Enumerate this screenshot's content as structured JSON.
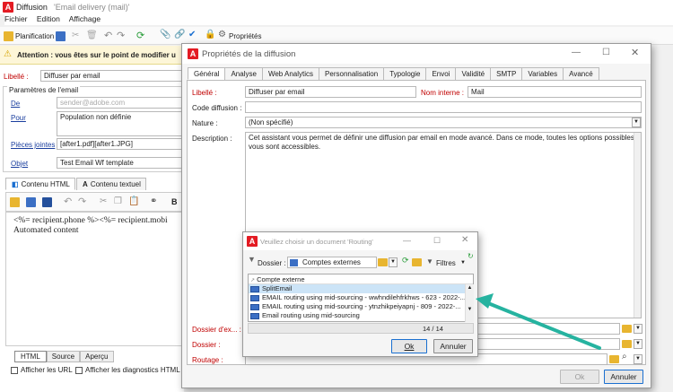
{
  "main_window": {
    "title": "Diffusion",
    "subtitle": "'Email delivery (mail)'",
    "menu": [
      "Fichier",
      "Edition",
      "Affichage"
    ],
    "toolbar": {
      "planification": "Planification",
      "proprietes": "Propriétés"
    },
    "warning": "Attention : vous êtes sur le point de modifier u",
    "libelle_label": "Libellé :",
    "libelle_value": "Diffuser par email",
    "params_title": "Paramètres de l'email",
    "de_label": "De",
    "de_value": "sender@adobe.com",
    "pour_label": "Pour",
    "pour_value": "Population non définie",
    "pj_label": "Pièces jointes",
    "pj_value": "[after1.pdf][after1.JPG]",
    "objet_label": "Objet",
    "objet_value": "Test Email Wf template",
    "content_tabs": [
      "Contenu HTML",
      "Contenu textuel"
    ],
    "editor_line1": "<%= recipient.phone %><%= recipient.mobi",
    "editor_line2": "Automated content",
    "bottom_tabs": [
      "HTML",
      "Source",
      "Aperçu"
    ],
    "check_urls": "Afficher les URL",
    "check_diag": "Afficher les diagnostics HTML"
  },
  "props_dialog": {
    "title": "Propriétés de la diffusion",
    "tabs": [
      "Général",
      "Analyse",
      "Web Analytics",
      "Personnalisation",
      "Typologie",
      "Envoi",
      "Validité",
      "SMTP",
      "Variables",
      "Avancé"
    ],
    "libelle_label": "Libellé :",
    "libelle_value": "Diffuser par email",
    "nom_interne_label": "Nom interne :",
    "nom_interne_value": "Mail",
    "code_label": "Code diffusion :",
    "code_value": "",
    "nature_label": "Nature :",
    "nature_value": "(Non spécifié)",
    "description_label": "Description :",
    "description_value": "Cet assistant vous permet de définir une diffusion par email en mode avancé. Dans ce mode, toutes les options possibles vous sont accessibles.",
    "dossier_ex_label": "Dossier d'ex... :",
    "dossier_label": "Dossier :",
    "routage_label": "Routage :",
    "ok": "Ok",
    "annuler": "Annuler"
  },
  "routing_dialog": {
    "title": "Veuillez choisir un document 'Routing'",
    "dossier_label": "Dossier :",
    "dossier_value": "Comptes externes",
    "filtres": "Filtres",
    "column_header": "Compte externe",
    "rows": [
      "SplitEmail",
      "EMAIL routing using mid-sourcing - wwhndilehfrkhws - 623 - 2022-...",
      "EMAIL routing using mid-sourcing - ytnzhikpeiyapnj - 809 - 2022-...",
      "Email routing using mid-sourcing"
    ],
    "count": "14 / 14",
    "ok": "Ok",
    "annuler": "Annuler"
  },
  "colors": {
    "accent": "#e31b23",
    "arrow": "#26b3a0",
    "selected": "#cce4f7",
    "label_red": "#c00000"
  }
}
